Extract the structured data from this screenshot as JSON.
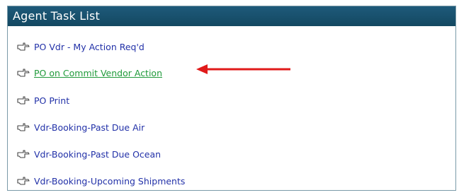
{
  "panel": {
    "title": "Agent Task List"
  },
  "tasks": [
    {
      "label": "PO Vdr - My Action Req'd",
      "icon": "pointing-hand-icon",
      "active": false
    },
    {
      "label": "PO on Commit Vendor Action",
      "icon": "pointing-hand-icon",
      "active": true
    },
    {
      "label": "PO Print",
      "icon": "pointing-hand-icon",
      "active": false
    },
    {
      "label": "Vdr-Booking-Past Due Air",
      "icon": "pointing-hand-icon",
      "active": false
    },
    {
      "label": "Vdr-Booking-Past Due Ocean",
      "icon": "pointing-hand-icon",
      "active": false
    },
    {
      "label": "Vdr-Booking-Upcoming Shipments",
      "icon": "pointing-hand-icon",
      "active": false
    }
  ],
  "colors": {
    "header_bg": "#1a5273",
    "link": "#2231a8",
    "active_link": "#1f9a3a",
    "annotation_arrow": "#e01a1a"
  }
}
